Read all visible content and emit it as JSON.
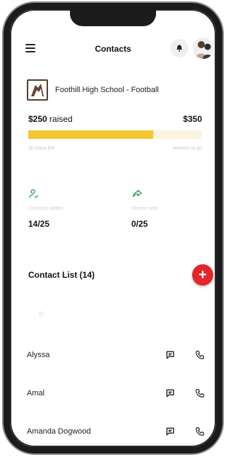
{
  "header": {
    "title": "Contacts",
    "menu_icon": "hamburger-menu-icon",
    "bell_icon": "bell-icon"
  },
  "team": {
    "name": "Foothill High School - Football"
  },
  "fundraising": {
    "raised_amount": "$250",
    "raised_label": "raised",
    "goal_amount": "$350",
    "progress_fraction": 0.72,
    "left_caption": "30 Days left",
    "right_caption": "Amount to go",
    "accent_color": "#f5c531"
  },
  "stats": [
    {
      "icon": "user-check-icon",
      "label": "Contacts added",
      "value": "14/25",
      "color": "#2fa35a"
    },
    {
      "icon": "share-arrow-icon",
      "label": "Shares sent",
      "value": "0/25",
      "color": "#2fa35a"
    }
  ],
  "contacts": {
    "title": "Contact List (14)",
    "add_label": "+",
    "add_color": "#e4262b",
    "items": [
      {
        "name": "Alyssa"
      },
      {
        "name": "Amal"
      },
      {
        "name": "Amanda Dogwood"
      }
    ]
  }
}
